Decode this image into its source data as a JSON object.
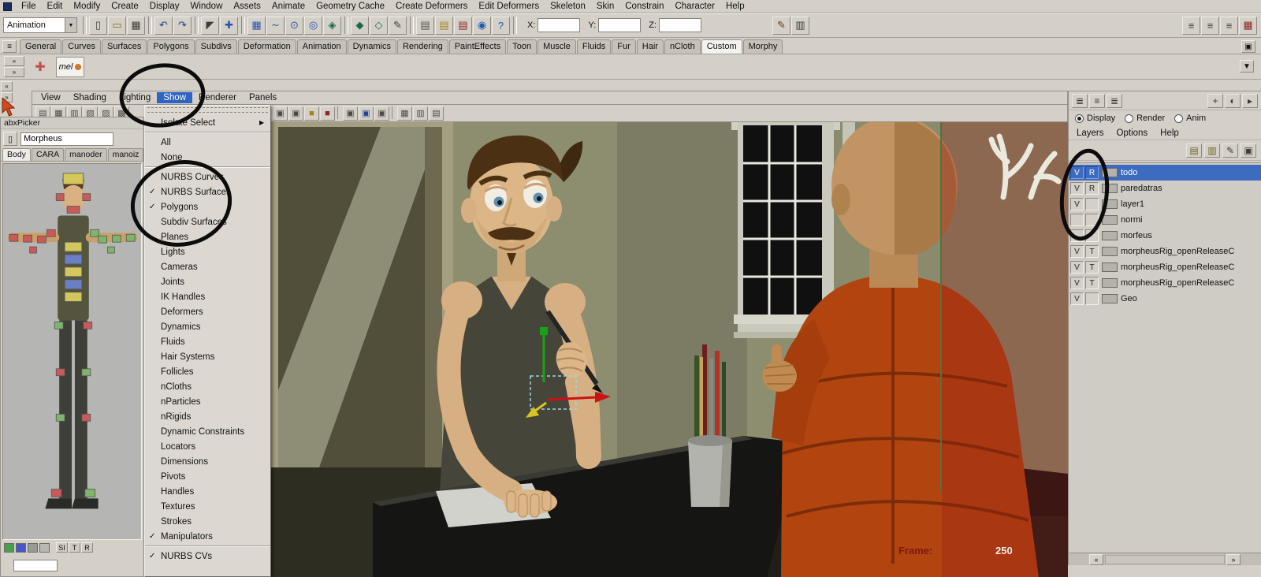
{
  "menubar": {
    "items": [
      "File",
      "Edit",
      "Modify",
      "Create",
      "Display",
      "Window",
      "Assets",
      "Animate",
      "Geometry Cache",
      "Create Deformers",
      "Edit Deformers",
      "Skeleton",
      "Skin",
      "Constrain",
      "Character",
      "Help"
    ]
  },
  "toolbar": {
    "menu_set": "Animation",
    "x_label": "X:",
    "y_label": "Y:",
    "z_label": "Z:",
    "icons": [
      {
        "name": "new-scene-icon",
        "glyph": "▯",
        "color": "#3c3c38"
      },
      {
        "name": "open-scene-icon",
        "glyph": "▭",
        "color": "#7a6a24"
      },
      {
        "name": "save-scene-icon",
        "glyph": "▦",
        "color": "#3c3c38"
      },
      {
        "sep": true
      },
      {
        "name": "undo-icon",
        "glyph": "↶",
        "color": "#1d3f8f"
      },
      {
        "name": "redo-icon",
        "glyph": "↷",
        "color": "#1d3f8f"
      },
      {
        "sep": true
      },
      {
        "name": "select-tool-icon",
        "glyph": "◤",
        "color": "#3c3c38"
      },
      {
        "name": "move-tool-icon",
        "glyph": "✚",
        "color": "#2a52b0"
      },
      {
        "sep": true
      },
      {
        "name": "snap-grid-icon",
        "glyph": "▦",
        "color": "#2a52b0"
      },
      {
        "name": "snap-curve-icon",
        "glyph": "∼",
        "color": "#2a52b0"
      },
      {
        "name": "snap-point-icon",
        "glyph": "⊙",
        "color": "#2a52b0"
      },
      {
        "name": "snap-view-plane-icon",
        "glyph": "◎",
        "color": "#2a52b0"
      },
      {
        "name": "make-live-icon",
        "glyph": "◈",
        "color": "#1a6a4a"
      },
      {
        "sep": true
      },
      {
        "name": "input-connections-icon",
        "glyph": "◆",
        "color": "#1a6a4a"
      },
      {
        "name": "output-connections-icon",
        "glyph": "◇",
        "color": "#1a6a4a"
      },
      {
        "name": "construction-history-icon",
        "glyph": "✎",
        "color": "#3c3c38"
      },
      {
        "sep": true
      },
      {
        "name": "render-view-icon",
        "glyph": "▤",
        "color": "#55524c"
      },
      {
        "name": "render-current-frame-icon",
        "glyph": "▤",
        "color": "#a8821a"
      },
      {
        "name": "ipr-render-icon",
        "glyph": "▤",
        "color": "#8a2525"
      },
      {
        "name": "render-globe-icon",
        "glyph": "◉",
        "color": "#1d5faf"
      },
      {
        "name": "help-line-icon",
        "glyph": "?",
        "color": "#1d5faf"
      },
      {
        "sep": true
      }
    ],
    "icons_right": [
      {
        "name": "paint-effects-icon",
        "glyph": "✎",
        "color": "#6a3a1a"
      },
      {
        "name": "hypershade-icon",
        "glyph": "▥",
        "color": "#3c3c38"
      }
    ],
    "icons_far_right": [
      {
        "name": "list-view-icon",
        "glyph": "≡",
        "color": "#3c3c38"
      },
      {
        "name": "detail-view-icon",
        "glyph": "≡",
        "color": "#3c3c38"
      },
      {
        "name": "outline-view-icon",
        "glyph": "≡",
        "color": "#3c3c38"
      },
      {
        "name": "attribute-editor-icon",
        "glyph": "▦",
        "color": "#8a2525"
      }
    ]
  },
  "shelf": {
    "tabs": [
      {
        "label": "General"
      },
      {
        "label": "Curves"
      },
      {
        "label": "Surfaces"
      },
      {
        "label": "Polygons"
      },
      {
        "label": "Subdivs"
      },
      {
        "label": "Deformation"
      },
      {
        "label": "Animation"
      },
      {
        "label": "Dynamics"
      },
      {
        "label": "Rendering"
      },
      {
        "label": "PaintEffects"
      },
      {
        "label": "Toon"
      },
      {
        "label": "Muscle"
      },
      {
        "label": "Fluids"
      },
      {
        "label": "Fur"
      },
      {
        "label": "Hair"
      },
      {
        "label": "nCloth"
      },
      {
        "label": "Custom",
        "active": true
      },
      {
        "label": "Morphy"
      }
    ],
    "mel_item": "mel"
  },
  "panel_menu": {
    "items": [
      {
        "label": "View"
      },
      {
        "label": "Shading"
      },
      {
        "label": "Lighting"
      },
      {
        "label": "Show",
        "highlighted": true
      },
      {
        "label": "Renderer"
      },
      {
        "label": "Panels"
      }
    ]
  },
  "show_menu": {
    "items": [
      {
        "label": "Isolate Select",
        "arrow": "▶",
        "sep_after": true
      },
      {
        "label": "All"
      },
      {
        "label": "None",
        "sep_after": true
      },
      {
        "label": "NURBS Curves"
      },
      {
        "label": "NURBS Surfaces",
        "check": "✓"
      },
      {
        "label": "Polygons",
        "check": "✓"
      },
      {
        "label": "Subdiv Surfaces"
      },
      {
        "label": "Planes"
      },
      {
        "label": "Lights"
      },
      {
        "label": "Cameras"
      },
      {
        "label": "Joints"
      },
      {
        "label": "IK Handles"
      },
      {
        "label": "Deformers"
      },
      {
        "label": "Dynamics"
      },
      {
        "label": "Fluids"
      },
      {
        "label": "Hair Systems"
      },
      {
        "label": "Follicles"
      },
      {
        "label": "nCloths"
      },
      {
        "label": "nParticles"
      },
      {
        "label": "nRigids"
      },
      {
        "label": "Dynamic Constraints"
      },
      {
        "label": "Locators"
      },
      {
        "label": "Dimensions"
      },
      {
        "label": "Pivots"
      },
      {
        "label": "Handles"
      },
      {
        "label": "Textures"
      },
      {
        "label": "Strokes"
      },
      {
        "label": "Manipulators",
        "check": "✓",
        "sep_after": true
      },
      {
        "label": "NURBS CVs",
        "check": "✓"
      }
    ]
  },
  "viewport": {
    "hud_frame_label": "Frame:",
    "hud_frame_value": "250",
    "icons_left": [
      {
        "name": "single-pane-icon",
        "glyph": "▤",
        "color": "#4a4a44"
      },
      {
        "name": "four-pane-icon",
        "glyph": "▦",
        "color": "#4a4a44"
      },
      {
        "name": "persp-outliner-icon",
        "glyph": "▥",
        "color": "#4a4a44"
      },
      {
        "name": "hypergraph-pane-icon",
        "glyph": "▧",
        "color": "#4a4a44"
      },
      {
        "name": "render-pane-icon",
        "glyph": "▨",
        "color": "#4a4a44"
      },
      {
        "name": "script-pane-icon",
        "glyph": "▩",
        "color": "#4a4a44"
      }
    ],
    "icons": [
      {
        "name": "select-camera-icon",
        "glyph": "▣",
        "color": "#4a4a44"
      },
      {
        "name": "lock-camera-icon",
        "glyph": "▣",
        "color": "#4a4a44"
      },
      {
        "name": "camera-attributes-icon",
        "glyph": "■",
        "color": "#a8821a"
      },
      {
        "name": "bookmark-icon",
        "glyph": "■",
        "color": "#8a2525"
      },
      {
        "sep": true
      },
      {
        "name": "image-plane-icon",
        "glyph": "▣",
        "color": "#4a4a44"
      },
      {
        "name": "two-d-pan-icon",
        "glyph": "▣",
        "color": "#24449a"
      },
      {
        "name": "oversampling-icon",
        "glyph": "▣",
        "color": "#4a4a44"
      },
      {
        "sep": true
      },
      {
        "name": "grid-toggle-icon",
        "glyph": "▦",
        "color": "#4a4a44"
      },
      {
        "name": "film-gate-icon",
        "glyph": "▥",
        "color": "#4a4a44"
      },
      {
        "name": "resolution-gate-icon",
        "glyph": "▤",
        "color": "#4a4a44"
      }
    ]
  },
  "layer_editor": {
    "top_icons_left": [
      {
        "name": "channel-box-layout-icon",
        "glyph": "≣",
        "color": "#3c3c38"
      },
      {
        "name": "layer-editor-layout-icon",
        "glyph": "≡",
        "color": "#3c3c38"
      },
      {
        "name": "split-layout-icon",
        "glyph": "≣",
        "color": "#3c3c38"
      }
    ],
    "top_icons_right": [
      {
        "name": "manipulator-icon",
        "glyph": "+",
        "color": "#3c3c38"
      },
      {
        "name": "render-sphere-icon",
        "glyph": "◐",
        "color": "#3c3c38"
      },
      {
        "name": "expand-panel-icon",
        "glyph": "▸",
        "color": "#3c3c38"
      }
    ],
    "radios": [
      {
        "label": "Display",
        "on": true
      },
      {
        "label": "Render"
      },
      {
        "label": "Anim"
      }
    ],
    "menu": [
      "Layers",
      "Options",
      "Help"
    ],
    "icons": [
      {
        "name": "move-layer-up-icon",
        "glyph": "▤",
        "color": "#6a6428"
      },
      {
        "name": "move-layer-down-icon",
        "glyph": "▥",
        "color": "#6a6428"
      },
      {
        "name": "empty-layer-icon",
        "glyph": "✎",
        "color": "#3c3c38"
      },
      {
        "name": "new-layer-icon",
        "glyph": "▣",
        "color": "#3c3c38"
      }
    ],
    "layers": [
      {
        "v": "V",
        "mode": "R",
        "name": "todo",
        "selected": true
      },
      {
        "v": "V",
        "mode": "R",
        "name": "paredatras"
      },
      {
        "v": "V",
        "mode": "",
        "name": "layer1"
      },
      {
        "v": "",
        "mode": "",
        "name": "normi"
      },
      {
        "v": "",
        "mode": "",
        "name": "morfeus"
      },
      {
        "v": "V",
        "mode": "T",
        "name": "morpheusRig_openReleaseC"
      },
      {
        "v": "V",
        "mode": "T",
        "name": "morpheusRig_openReleaseC"
      },
      {
        "v": "V",
        "mode": "T",
        "name": "morpheusRig_openReleaseC"
      },
      {
        "v": "V",
        "mode": "",
        "name": "Geo"
      }
    ]
  },
  "picker": {
    "title": "abxPicker",
    "name_field": "Morpheus",
    "tabs": [
      {
        "label": "Body",
        "active": true
      },
      {
        "label": "CARA"
      },
      {
        "label": "manoder"
      },
      {
        "label": "manoiz"
      }
    ],
    "swatches": [
      "#4aa04a",
      "#4a56c8",
      "#9a9a94",
      "#b8b8b2"
    ],
    "footer_buttons": [
      "SI",
      "T",
      "R"
    ]
  },
  "annotations": {
    "color": "#0c0c0c",
    "circles": [
      "show-menu-circle",
      "checkmarks-circle",
      "layer-visibility-circle"
    ]
  },
  "colors": {
    "ui_gray": "#d4d0c8",
    "menu_highlight": "#2f63c4",
    "selected_layer": "#3c6bc0",
    "viewport_wall": "#8d8d70",
    "mannequin_orange": "#b24410",
    "hud_label": "#7c1a12"
  }
}
